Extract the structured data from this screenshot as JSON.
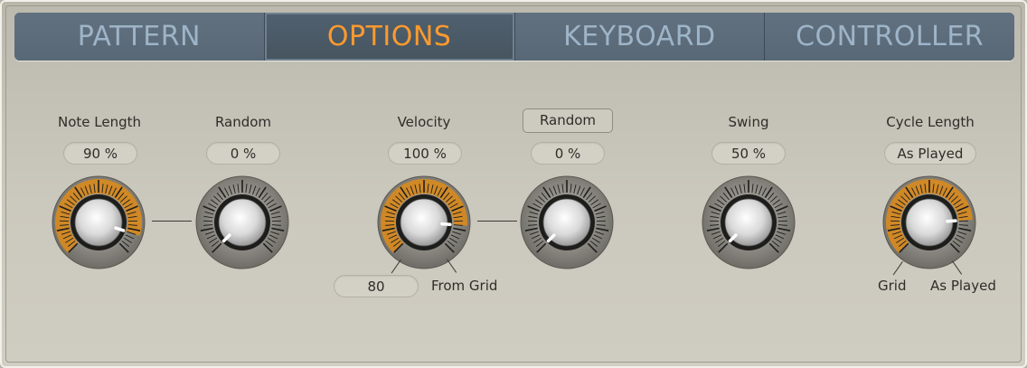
{
  "tabs": [
    {
      "label": "PATTERN",
      "active": false
    },
    {
      "label": "OPTIONS",
      "active": true
    },
    {
      "label": "KEYBOARD",
      "active": false
    },
    {
      "label": "CONTROLLER",
      "active": false
    }
  ],
  "controls": {
    "note_length": {
      "label": "Note Length",
      "value": "90 %",
      "level": 0.9,
      "arc": true
    },
    "note_length_random": {
      "label": "Random",
      "value": "0 %",
      "level": 0.0,
      "arc": false
    },
    "velocity": {
      "label": "Velocity",
      "value": "100 %",
      "level": 0.85,
      "arc": true,
      "min_value": "80",
      "max_label": "From Grid"
    },
    "velocity_random": {
      "label": "Random",
      "value": "0 %",
      "level": 0.0,
      "arc": false
    },
    "swing": {
      "label": "Swing",
      "value": "50 %",
      "level": 0.0,
      "arc": false
    },
    "cycle_length": {
      "label": "Cycle Length",
      "value": "As Played",
      "level": 0.82,
      "arc": true,
      "min_label": "Grid",
      "max_label": "As Played"
    }
  },
  "colors": {
    "accent": "#ff9a2e",
    "tab_bg": "#5a6a79",
    "tab_text": "#9eb4c8",
    "arc": "#d88a1e"
  },
  "icons": [
    "knob-icon"
  ]
}
